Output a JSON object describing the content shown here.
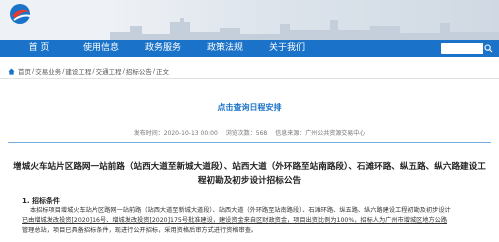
{
  "nav": {
    "items": [
      "首 页",
      "使用信息",
      "政务服务",
      "政策法规",
      "关于我们"
    ],
    "search_placeholder": ""
  },
  "breadcrumb": {
    "items": [
      "首页",
      "交易业务",
      "建设工程",
      "交通工程",
      "招标公告",
      "正文"
    ],
    "separator": "/"
  },
  "schedule_link": "点击查询日程安排",
  "meta": {
    "published": "发布时间：2020-10-13 00:00",
    "views": "浏览次数：568",
    "source": "信息来源：广州公共资源交易中心"
  },
  "title": "增城火车站片区路网一站前路（站西大道至新城大道段）、站西大道（外环路至站南路段）、石滩环路、纵五路、纵六路建设工程初勘及初步设计招标公告",
  "section_heading": "1. 招标条件",
  "body_lines": [
    "本招标项目增城火车站片区路网一站前路（站西大道至新城大道段）、站西大道（外环路至站南路段）、石滩环路、纵五路、纵六路建设工程初勘及初步设计",
    "已由增城发改投资[2020]16号、增城发改投资[2020]175号批准建设，建设资金来自区财政资金，项目出资比例为100%，招标人为广州市增城区地方公路",
    "管理总站，项目已具备招标条件，现进行公开招标，采用资格后审方式进行资格审查。"
  ],
  "colors": {
    "nav": "#1a73c8",
    "link": "#1a73c8"
  }
}
